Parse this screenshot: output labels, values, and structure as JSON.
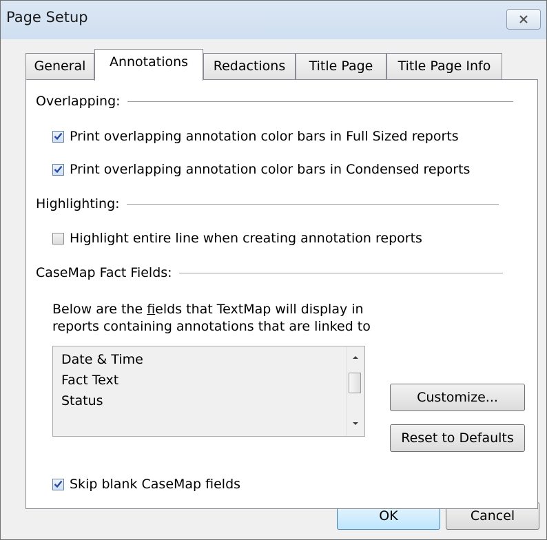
{
  "window": {
    "title": "Page Setup"
  },
  "tabs": [
    {
      "label": "General",
      "active": false
    },
    {
      "label": "Annotations",
      "active": true
    },
    {
      "label": "Redactions",
      "active": false
    },
    {
      "label": "Title Page",
      "active": false
    },
    {
      "label": "Title Page Info",
      "active": false
    }
  ],
  "overlapping": {
    "heading": "Overlapping:",
    "full_sized": {
      "label": "Print overlapping annotation color bars in Full Sized reports",
      "checked": true
    },
    "condensed": {
      "label": "Print overlapping annotation color bars in Condensed reports",
      "checked": true
    }
  },
  "highlighting": {
    "heading": "Highlighting:",
    "entire_line": {
      "label": "Highlight entire line when creating annotation reports",
      "checked": false
    }
  },
  "casemap": {
    "heading": "CaseMap Fact Fields:",
    "description_pre": "Below are the ",
    "description_accel": "f",
    "description_post": "ields that TextMap will display in",
    "description_line2": "reports containing annotations that are linked to",
    "fields": [
      "Date & Time",
      "Fact Text",
      "Status"
    ],
    "customize_label": "Customize...",
    "reset_label": "Reset to Defaults",
    "skip_blank": {
      "label": "Skip blank CaseMap fields",
      "checked": true
    }
  },
  "footer": {
    "ok_label": "OK",
    "cancel_label": "Cancel"
  },
  "colors": {
    "titlebar": "#dce7f4",
    "check": "#2b4a9f",
    "default_button": "#3c7fb1"
  }
}
